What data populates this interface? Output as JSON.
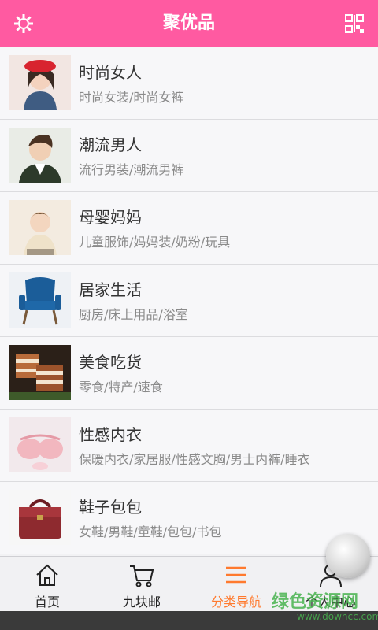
{
  "header": {
    "title": "聚优品",
    "left_icon": "gear-icon",
    "right_icon": "qr-scan-icon",
    "color": "#ff5aa1"
  },
  "categories": [
    {
      "name": "时尚女人",
      "sub": "时尚女装/时尚女裤",
      "thumb_icon": "woman-photo"
    },
    {
      "name": "潮流男人",
      "sub": "流行男装/潮流男裤",
      "thumb_icon": "man-photo"
    },
    {
      "name": "母婴妈妈",
      "sub": "儿童服饰/妈妈装/奶粉/玩具",
      "thumb_icon": "child-photo"
    },
    {
      "name": "居家生活",
      "sub": "厨房/床上用品/浴室",
      "thumb_icon": "armchair-photo"
    },
    {
      "name": "美食吃货",
      "sub": "零食/特产/速食",
      "thumb_icon": "cake-photo"
    },
    {
      "name": "性感内衣",
      "sub": "保暖内衣/家居服/性感文胸/男士内裤/睡衣",
      "thumb_icon": "bra-photo"
    },
    {
      "name": "鞋子包包",
      "sub": "女鞋/男鞋/童鞋/包包/书包",
      "thumb_icon": "handbag-photo"
    }
  ],
  "tabs": [
    {
      "label": "首页",
      "icon": "home-icon"
    },
    {
      "label": "九块邮",
      "icon": "cart-icon"
    },
    {
      "label": "分类导航",
      "icon": "menu-icon",
      "active": true
    },
    {
      "label": "个人中心",
      "icon": "user-icon"
    }
  ],
  "watermark": {
    "main": "绿色资源网",
    "sub": "www.downcc.com"
  },
  "active_color": "#ff7a2e"
}
